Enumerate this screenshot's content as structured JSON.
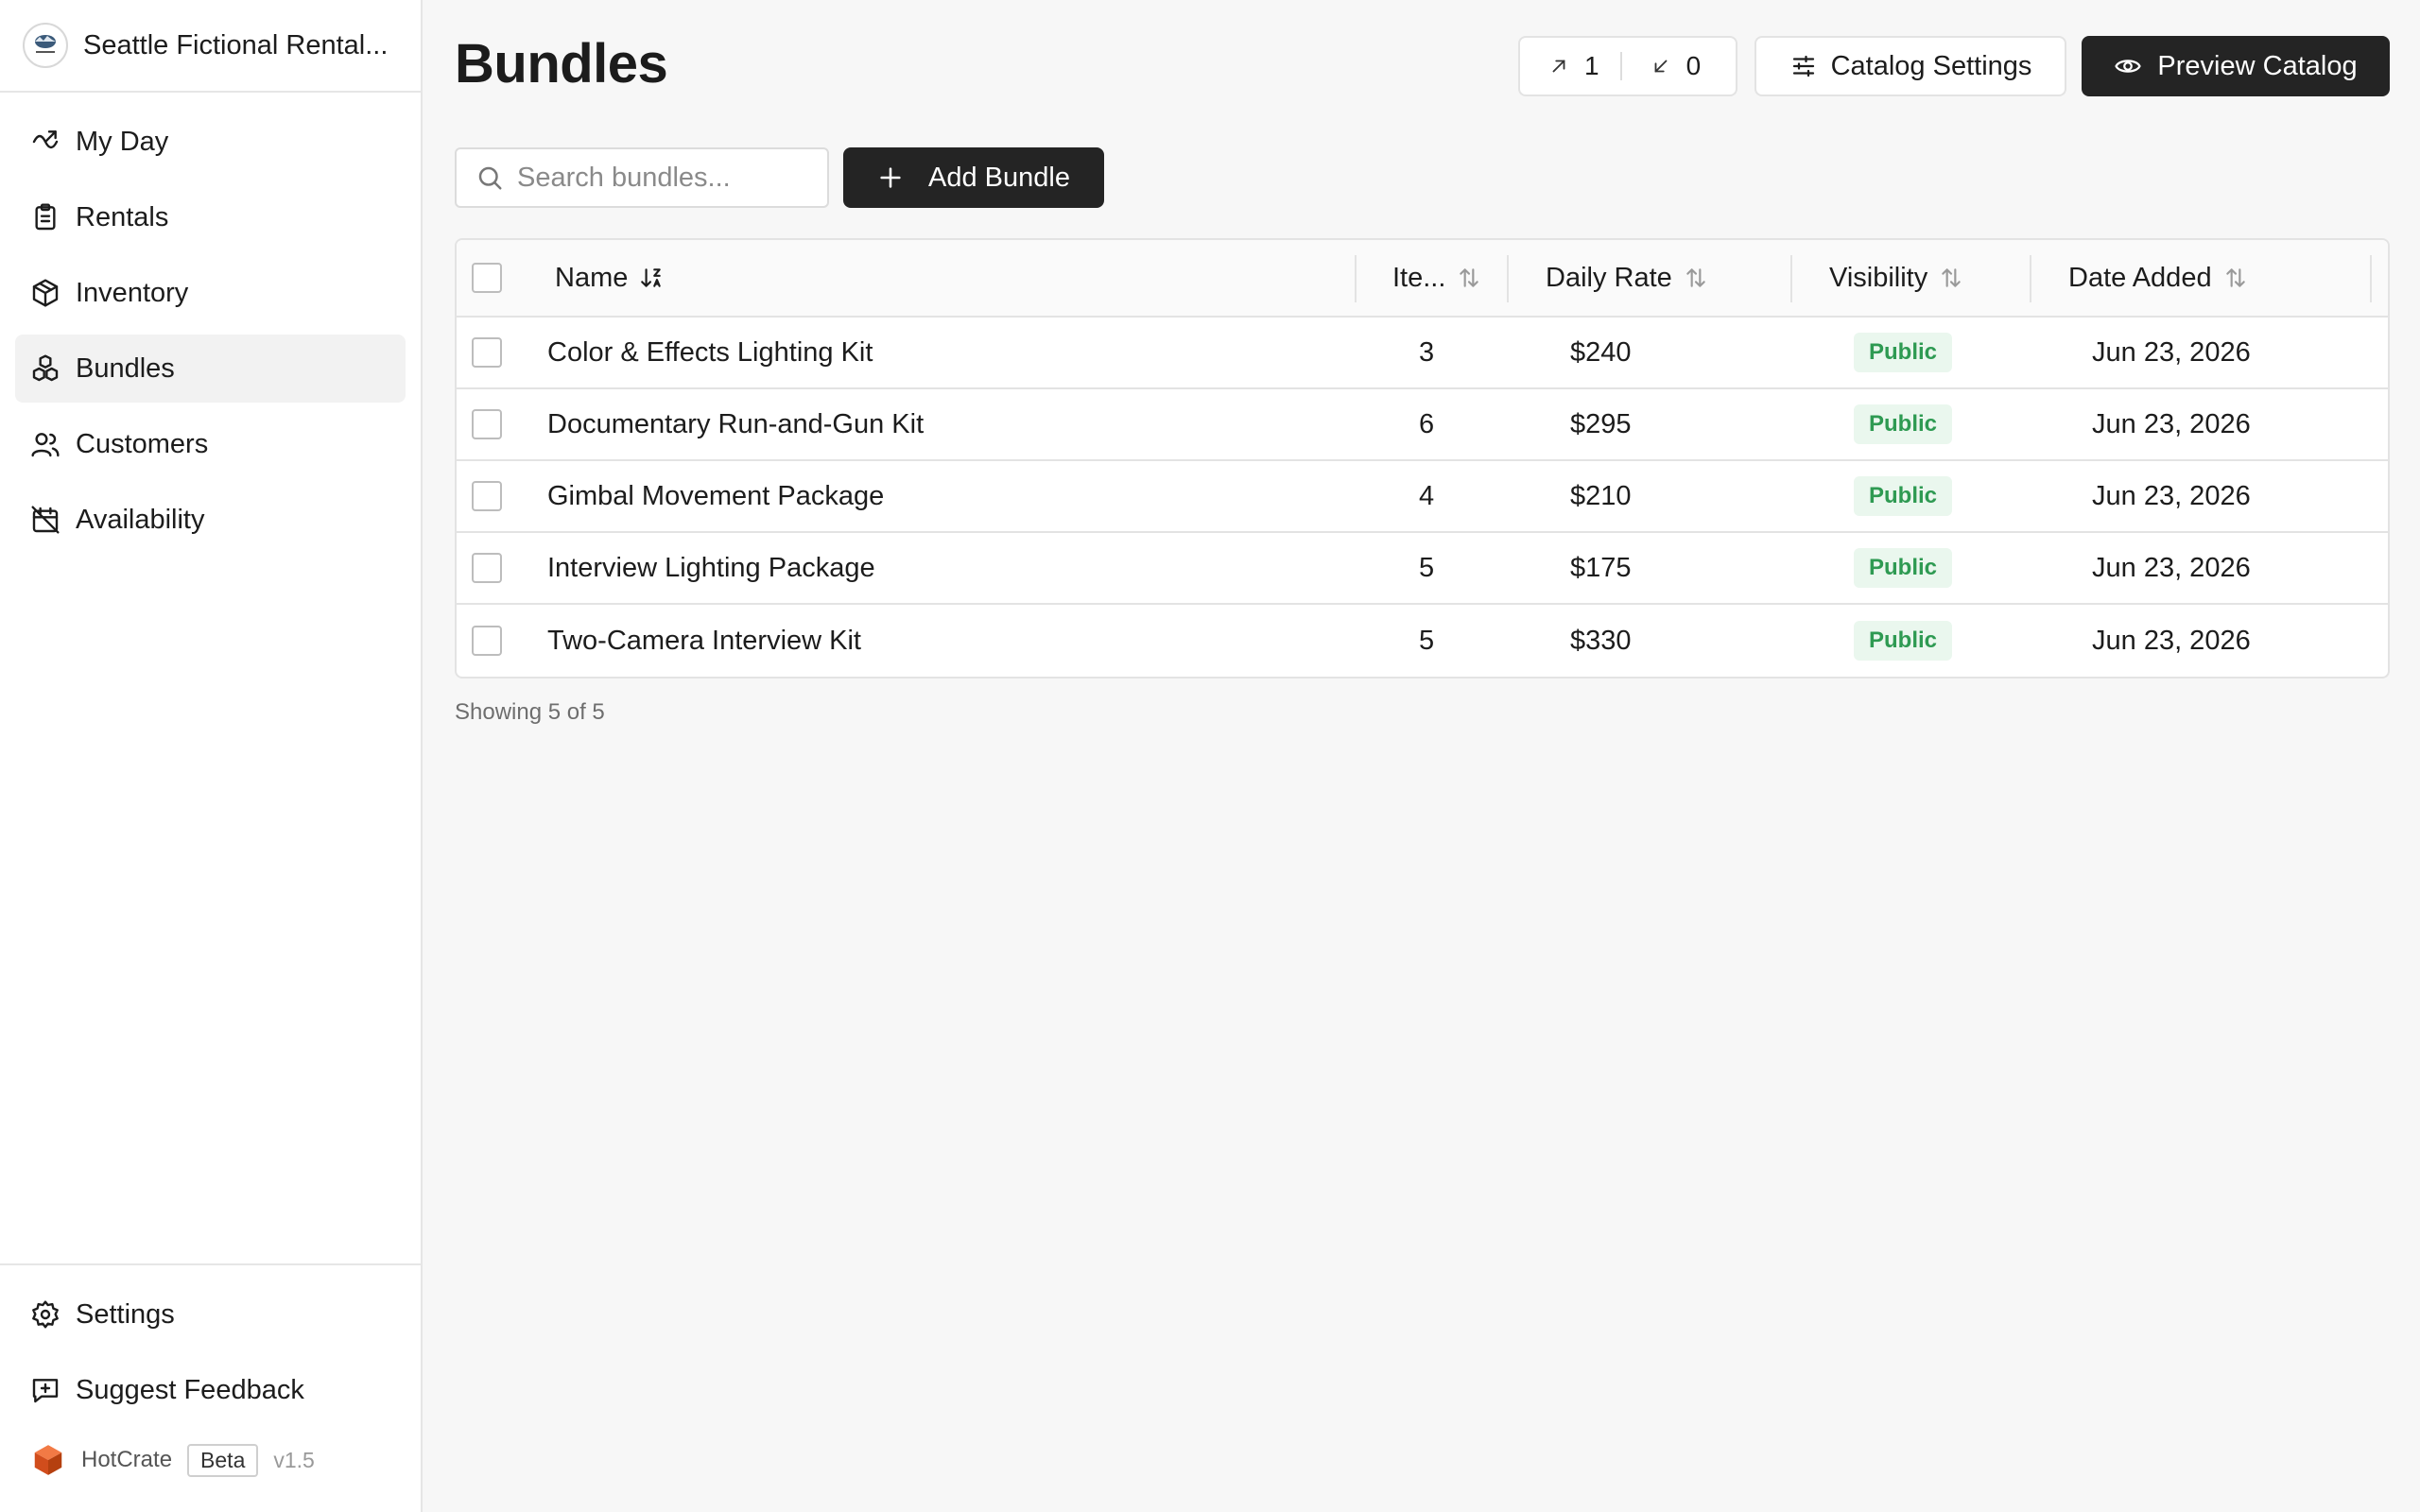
{
  "sidebar": {
    "org_name": "Seattle Fictional Rental...",
    "nav": [
      {
        "label": "My Day",
        "icon": "wave-icon"
      },
      {
        "label": "Rentals",
        "icon": "clipboard-icon"
      },
      {
        "label": "Inventory",
        "icon": "box-icon"
      },
      {
        "label": "Bundles",
        "icon": "bundles-icon",
        "active": true
      },
      {
        "label": "Customers",
        "icon": "users-icon"
      },
      {
        "label": "Availability",
        "icon": "calendar-off-icon"
      }
    ],
    "bottom": [
      {
        "label": "Settings",
        "icon": "gear-icon"
      },
      {
        "label": "Suggest Feedback",
        "icon": "feedback-icon"
      }
    ],
    "brand": {
      "name": "HotCrate",
      "badge": "Beta",
      "version": "v1.5"
    }
  },
  "header": {
    "title": "Bundles",
    "counter_up": "1",
    "counter_down": "0",
    "catalog_settings": "Catalog Settings",
    "preview_catalog": "Preview Catalog"
  },
  "toolbar": {
    "search_placeholder": "Search bundles...",
    "add_label": "Add Bundle"
  },
  "table": {
    "columns": {
      "name": "Name",
      "items": "Ite...",
      "rate": "Daily Rate",
      "visibility": "Visibility",
      "date": "Date Added"
    },
    "rows": [
      {
        "name": "Color & Effects Lighting Kit",
        "items": "3",
        "rate": "$240",
        "visibility": "Public",
        "date": "Jun 23, 2026"
      },
      {
        "name": "Documentary Run-and-Gun Kit",
        "items": "6",
        "rate": "$295",
        "visibility": "Public",
        "date": "Jun 23, 2026"
      },
      {
        "name": "Gimbal Movement Package",
        "items": "4",
        "rate": "$210",
        "visibility": "Public",
        "date": "Jun 23, 2026"
      },
      {
        "name": "Interview Lighting Package",
        "items": "5",
        "rate": "$175",
        "visibility": "Public",
        "date": "Jun 23, 2026"
      },
      {
        "name": "Two-Camera Interview Kit",
        "items": "5",
        "rate": "$330",
        "visibility": "Public",
        "date": "Jun 23, 2026"
      }
    ]
  },
  "footer": {
    "showing": "Showing 5 of 5"
  },
  "colors": {
    "accent_dark": "#242424",
    "public_badge_bg": "#eaf7ee",
    "public_badge_text": "#2e9a52",
    "brand_cube": "#e05a2a"
  }
}
